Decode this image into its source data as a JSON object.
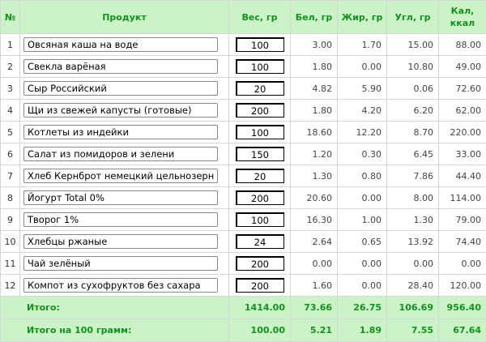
{
  "headers": {
    "num": "№",
    "product": "Продукт",
    "weight": "Вес, гр",
    "protein": "Бел, гр",
    "fat": "Жир, гр",
    "carbs": "Угл, гр",
    "kcal_line1": "Кал,",
    "kcal_line2": "ккал"
  },
  "rows": [
    {
      "n": "1",
      "name": "Овсяная каша на воде",
      "weight": "100",
      "protein": "3.00",
      "fat": "1.70",
      "carbs": "15.00",
      "kcal": "88.00"
    },
    {
      "n": "2",
      "name": "Свекла варёная",
      "weight": "100",
      "protein": "1.80",
      "fat": "0.00",
      "carbs": "10.80",
      "kcal": "49.00"
    },
    {
      "n": "3",
      "name": "Сыр Российский",
      "weight": "20",
      "protein": "4.82",
      "fat": "5.90",
      "carbs": "0.06",
      "kcal": "72.60"
    },
    {
      "n": "4",
      "name": "Щи из свежей капусты (готовые)",
      "weight": "200",
      "protein": "1.80",
      "fat": "4.20",
      "carbs": "6.20",
      "kcal": "62.00"
    },
    {
      "n": "5",
      "name": "Котлеты из индейки",
      "weight": "100",
      "protein": "18.60",
      "fat": "12.20",
      "carbs": "8.70",
      "kcal": "220.00"
    },
    {
      "n": "6",
      "name": "Салат из помидоров и зелени",
      "weight": "150",
      "protein": "1.20",
      "fat": "0.30",
      "carbs": "6.45",
      "kcal": "33.00"
    },
    {
      "n": "7",
      "name": "Хлеб Кернброт немецкий цельнозерновой",
      "weight": "20",
      "protein": "1.30",
      "fat": "0.80",
      "carbs": "7.86",
      "kcal": "44.40"
    },
    {
      "n": "8",
      "name": "Йогурт Total 0%",
      "weight": "200",
      "protein": "20.60",
      "fat": "0.00",
      "carbs": "8.00",
      "kcal": "114.00"
    },
    {
      "n": "9",
      "name": "Творог 1%",
      "weight": "100",
      "protein": "16.30",
      "fat": "1.00",
      "carbs": "1.30",
      "kcal": "79.00"
    },
    {
      "n": "10",
      "name": "Хлебцы ржаные",
      "weight": "24",
      "protein": "2.64",
      "fat": "0.65",
      "carbs": "13.92",
      "kcal": "74.40"
    },
    {
      "n": "11",
      "name": "Чай зелёный",
      "weight": "200",
      "protein": "0.00",
      "fat": "0.00",
      "carbs": "0.00",
      "kcal": "0.00"
    },
    {
      "n": "12",
      "name": "Компот из сухофруктов без сахара",
      "weight": "200",
      "protein": "1.60",
      "fat": "0.00",
      "carbs": "28.40",
      "kcal": "120.00"
    }
  ],
  "totals": {
    "label": "Итого:",
    "weight": "1414.00",
    "protein": "73.66",
    "fat": "26.75",
    "carbs": "106.69",
    "kcal": "956.40"
  },
  "per100": {
    "label": "Итого на 100 грамм:",
    "weight": "100.00",
    "protein": "5.21",
    "fat": "1.89",
    "carbs": "7.55",
    "kcal": "67.64"
  },
  "colors": {
    "header_bg": "#ccf3c8",
    "header_text": "#12911e"
  }
}
